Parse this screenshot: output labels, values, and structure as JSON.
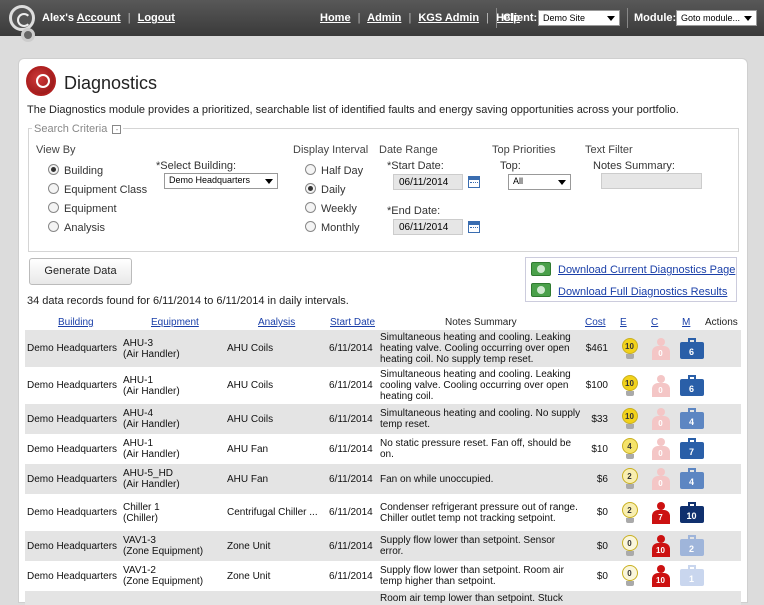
{
  "topbar": {
    "user_greeting": "Alex's",
    "account_label": "Account",
    "logout_label": "Logout",
    "separator": "|",
    "nav": [
      "Home",
      "Admin",
      "KGS Admin",
      "Help"
    ],
    "client_label": "Client:",
    "client_value": "Demo Site",
    "module_label": "Module:",
    "module_value": "Goto module..."
  },
  "page": {
    "title": "Diagnostics",
    "description": "The Diagnostics module provides a prioritized, searchable list of identified faults and energy saving opportunities across your portfolio."
  },
  "criteria": {
    "legend": "Search Criteria",
    "collapse_glyph": "-",
    "view_by": {
      "label": "View By",
      "options": [
        "Building",
        "Equipment Class",
        "Equipment",
        "Analysis"
      ],
      "selected": "Building"
    },
    "select_building": {
      "label": "*Select Building:",
      "value": "Demo Headquarters"
    },
    "display_interval": {
      "label": "Display Interval",
      "options": [
        "Half Day",
        "Daily",
        "Weekly",
        "Monthly"
      ],
      "selected": "Daily"
    },
    "date_range": {
      "label": "Date Range",
      "start_label": "*Start Date:",
      "start_value": "06/11/2014",
      "end_label": "*End Date:",
      "end_value": "06/11/2014"
    },
    "top_priorities": {
      "label": "Top Priorities",
      "top_label": "Top:",
      "top_value": "All"
    },
    "text_filter": {
      "label": "Text Filter",
      "notes_label": "Notes Summary:",
      "notes_value": ""
    }
  },
  "actions": {
    "generate_label": "Generate Data",
    "download_current": "Download Current Diagnostics Page",
    "download_full": "Download Full Diagnostics Results"
  },
  "records_text": "34 data records found for 6/11/2014 to 6/11/2014 in daily intervals.",
  "table": {
    "headers": {
      "building": "Building",
      "equipment": "Equipment",
      "analysis": "Analysis",
      "start_date": "Start Date",
      "notes": "Notes Summary",
      "cost": "Cost",
      "e": "E",
      "c": "C",
      "m": "M",
      "actions": "Actions"
    },
    "rows": [
      {
        "building": "Demo Headquarters",
        "equipment": "AHU-3",
        "equipment_type": "(Air Handler)",
        "analysis": "AHU Coils",
        "start_date": "6/11/2014",
        "notes": "Simultaneous heating and cooling. Leaking heating valve. Cooling occurring over open heating coil. No supply temp reset.",
        "cost": "$461",
        "e": "10",
        "c": "0",
        "m": "6"
      },
      {
        "building": "Demo Headquarters",
        "equipment": "AHU-1",
        "equipment_type": "(Air Handler)",
        "analysis": "AHU Coils",
        "start_date": "6/11/2014",
        "notes": "Simultaneous heating and cooling. Leaking cooling valve. Cooling occurring over open heating coil.",
        "cost": "$100",
        "e": "10",
        "c": "0",
        "m": "6"
      },
      {
        "building": "Demo Headquarters",
        "equipment": "AHU-4",
        "equipment_type": "(Air Handler)",
        "analysis": "AHU Coils",
        "start_date": "6/11/2014",
        "notes": "Simultaneous heating and cooling. No supply temp reset.",
        "cost": "$33",
        "e": "10",
        "c": "0",
        "m": "4"
      },
      {
        "building": "Demo Headquarters",
        "equipment": "AHU-1",
        "equipment_type": "(Air Handler)",
        "analysis": "AHU Fan",
        "start_date": "6/11/2014",
        "notes": "No static pressure reset. Fan off, should be on.",
        "cost": "$10",
        "e": "4",
        "c": "0",
        "m": "7"
      },
      {
        "building": "Demo Headquarters",
        "equipment": "AHU-5_HD",
        "equipment_type": "(Air Handler)",
        "analysis": "AHU Fan",
        "start_date": "6/11/2014",
        "notes": "Fan on while unoccupied.",
        "cost": "$6",
        "e": "2",
        "c": "0",
        "m": "4"
      },
      {
        "building": "Demo Headquarters",
        "equipment": "Chiller 1",
        "equipment_type": "(Chiller)",
        "analysis": "Centrifugal Chiller ...",
        "start_date": "6/11/2014",
        "notes": "Condenser refrigerant pressure out of range. Chiller outlet temp not tracking setpoint.",
        "cost": "$0",
        "e": "2",
        "c": "7",
        "m": "10"
      },
      {
        "building": "Demo Headquarters",
        "equipment": "VAV1-3",
        "equipment_type": "(Zone Equipment)",
        "analysis": "Zone Unit",
        "start_date": "6/11/2014",
        "notes": "Supply flow lower than setpoint. Sensor error.",
        "cost": "$0",
        "e": "0",
        "c": "10",
        "m": "2"
      },
      {
        "building": "Demo Headquarters",
        "equipment": "VAV1-2",
        "equipment_type": "(Zone Equipment)",
        "analysis": "Zone Unit",
        "start_date": "6/11/2014",
        "notes": "Supply flow lower than setpoint. Room air temp higher than setpoint.",
        "cost": "$0",
        "e": "0",
        "c": "10",
        "m": "1"
      },
      {
        "building": "",
        "equipment": "",
        "equipment_type": "",
        "analysis": "",
        "start_date": "",
        "notes": "Room air temp lower than setpoint. Stuck",
        "cost": "",
        "e": "",
        "c": "",
        "m": ""
      }
    ]
  },
  "colors": {
    "link": "#1a3fa8",
    "alert_red": "#cc1111",
    "bulb_yellow": "#f2d21a",
    "tool_blue": "#2a5fa8"
  }
}
